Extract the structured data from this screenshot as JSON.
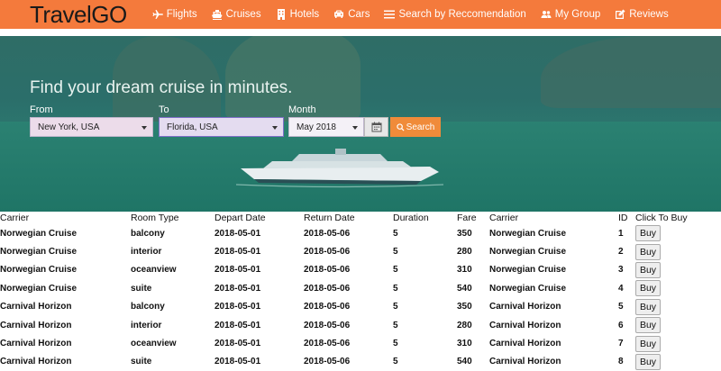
{
  "brand": "TravelGO",
  "nav": [
    {
      "label": "Flights",
      "icon": "plane-icon"
    },
    {
      "label": "Cruises",
      "icon": "ship-icon"
    },
    {
      "label": "Hotels",
      "icon": "building-icon"
    },
    {
      "label": "Cars",
      "icon": "car-icon"
    },
    {
      "label": "Search by Reccomendation",
      "icon": "list-icon"
    },
    {
      "label": "My Group",
      "icon": "users-icon"
    },
    {
      "label": "Reviews",
      "icon": "edit-icon"
    }
  ],
  "hero": {
    "title": "Find your dream cruise in minutes.",
    "from_label": "From",
    "from_value": "New York, USA",
    "to_label": "To",
    "to_value": "Florida, USA",
    "month_label": "Month",
    "month_value": "May 2018",
    "search_label": "Search"
  },
  "table": {
    "headers": [
      "Carrier",
      "Room Type",
      "Depart Date",
      "Return Date",
      "Duration",
      "Fare",
      "Carrier",
      "ID",
      "Click To Buy"
    ],
    "buy_label": "Buy",
    "rows": [
      [
        "Norwegian Cruise",
        "balcony",
        "2018-05-01",
        "2018-05-06",
        "5",
        "350",
        "Norwegian Cruise",
        "1"
      ],
      [
        "Norwegian Cruise",
        "interior",
        "2018-05-01",
        "2018-05-06",
        "5",
        "280",
        "Norwegian Cruise",
        "2"
      ],
      [
        "Norwegian Cruise",
        "oceanview",
        "2018-05-01",
        "2018-05-06",
        "5",
        "310",
        "Norwegian Cruise",
        "3"
      ],
      [
        "Norwegian Cruise",
        "suite",
        "2018-05-01",
        "2018-05-06",
        "5",
        "540",
        "Norwegian Cruise",
        "4"
      ],
      [
        "Carnival Horizon",
        "balcony",
        "2018-05-01",
        "2018-05-06",
        "5",
        "350",
        "Carnival Horizon",
        "5"
      ],
      [
        "Carnival Horizon",
        "interior",
        "2018-05-01",
        "2018-05-06",
        "5",
        "280",
        "Carnival Horizon",
        "6"
      ],
      [
        "Carnival Horizon",
        "oceanview",
        "2018-05-01",
        "2018-05-06",
        "5",
        "310",
        "Carnival Horizon",
        "7"
      ],
      [
        "Carnival Horizon",
        "suite",
        "2018-05-01",
        "2018-05-06",
        "5",
        "540",
        "Carnival Horizon",
        "8"
      ]
    ]
  }
}
